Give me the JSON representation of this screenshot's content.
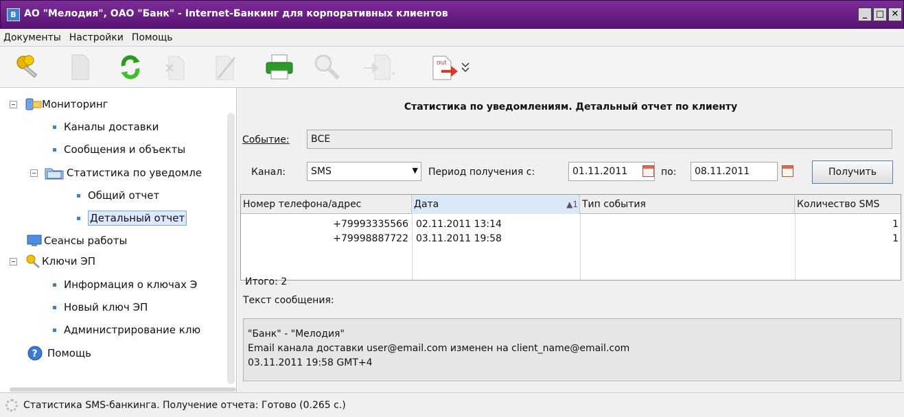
{
  "window": {
    "title": "АО \"Мелодия\", ОАО \"Банк\" - Internet-Банкинг для корпоративных клиентов",
    "app_icon": "app-icon",
    "accent": "#6a1f86"
  },
  "menu": [
    "Документы",
    "Настройки",
    "Помощь"
  ],
  "toolbar": {
    "icons": [
      "keys-icon",
      "new-document-icon",
      "refresh-icon",
      "delete-icon",
      "edit-icon",
      "sign-icon",
      "print-icon",
      "search-icon",
      "import-icon",
      "export-out-icon"
    ],
    "out_label": "out"
  },
  "tree": {
    "monitoring": "Мониторинг",
    "delivery_channels": "Каналы доставки",
    "messages_objects": "Сообщения и объекты",
    "notification_stats": "Статистика по уведомле",
    "general_report": "Общий отчет",
    "detailed_report": "Детальный отчет",
    "sessions": "Сеансы работы",
    "ep_keys": "Ключи ЭП",
    "key_info": "Информация о ключах Э",
    "new_key": "Новый ключ ЭП",
    "key_admin": "Администрирование клю",
    "help": "Помощь"
  },
  "report": {
    "heading": "Статистика по уведомлениям. Детальный отчет по клиенту",
    "event_label": "Событие:",
    "event_value": "ВСЕ",
    "channel_label": "Канал:",
    "channel_value": "SMS",
    "period_label": "Период получения с:",
    "date_from": "01.11.2011",
    "to_label": "по:",
    "date_to": "08.11.2011",
    "get_button": "Получить",
    "columns": [
      "Номер телефона/адрес",
      "Дата",
      "1",
      "Тип события",
      "Количество SMS"
    ],
    "rows": [
      {
        "phone": "+79993335566",
        "date": "02.11.2011 13:14",
        "type": "",
        "count": "1"
      },
      {
        "phone": "+79998887722",
        "date": "03.11.2011 19:58",
        "type": "",
        "count": "1"
      }
    ],
    "total": "Итого: 2",
    "message_label": "Текст сообщения:",
    "message_lines": [
      "\"Банк\" - \"Мелодия\"",
      "Email канала доставки user@email.com изменен на client_name@email.com",
      "03.11.2011 19:58 GMT+4"
    ]
  },
  "status": {
    "text": "Статистика SMS-банкинга. Получение отчета: Готово (0.265 с.)"
  }
}
